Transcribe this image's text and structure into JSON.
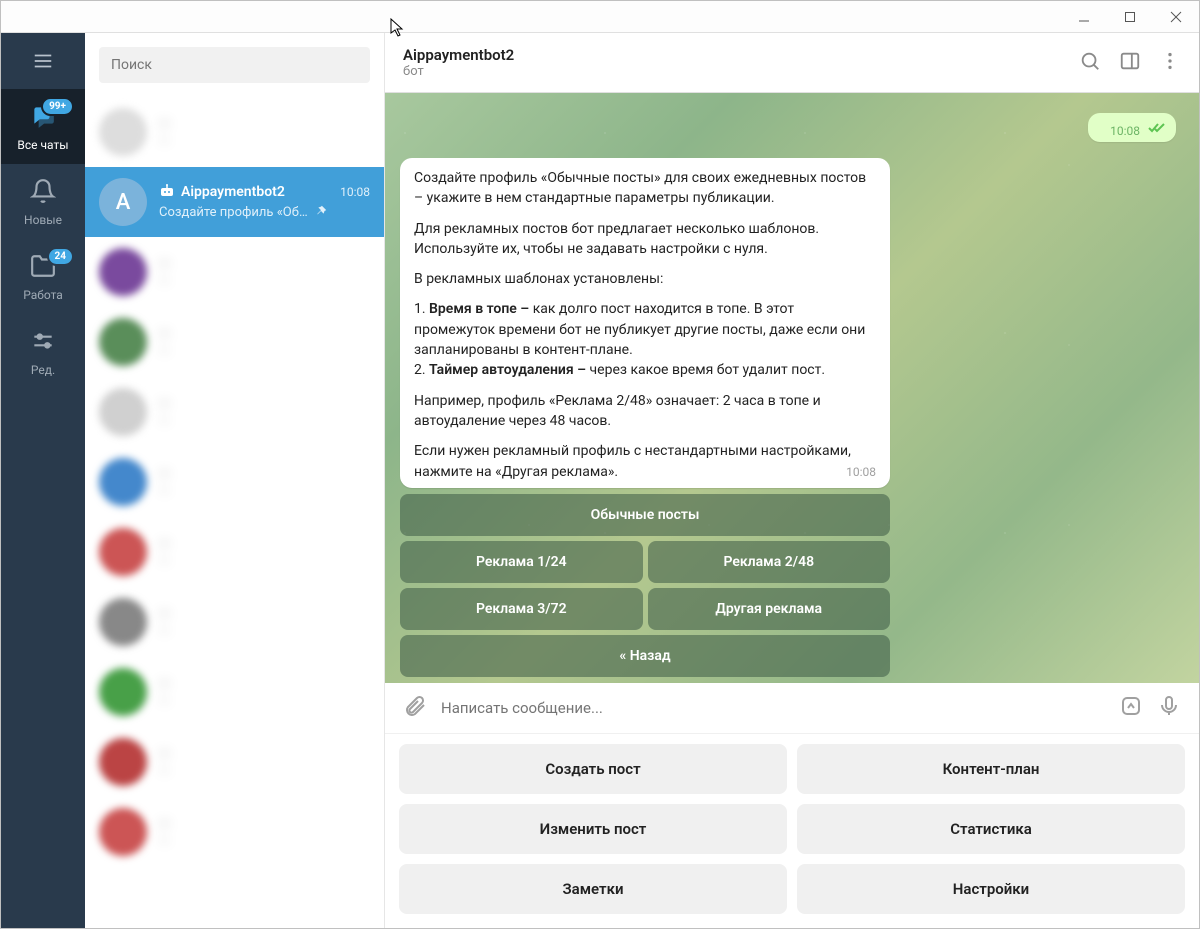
{
  "window": {
    "title": ""
  },
  "nav": {
    "items": [
      {
        "label": "Все чаты",
        "badge": "99+"
      },
      {
        "label": "Новые"
      },
      {
        "label": "Работа",
        "badge": "24"
      },
      {
        "label": "Ред."
      }
    ]
  },
  "search": {
    "placeholder": "Поиск"
  },
  "activeChat": {
    "avatar_letter": "A",
    "name": "Aippaymentbot2",
    "time": "10:08",
    "preview": "Создайте профиль «Об…"
  },
  "header": {
    "title": "Aippaymentbot2",
    "subtitle": "бот"
  },
  "outgoing": {
    "time": "10:08"
  },
  "message": {
    "p1": "Создайте профиль «Обычные посты» для своих ежедневных постов – укажите в нем стандартные параметры публикации.",
    "p2": "Для рекламных постов бот предлагает несколько шаблонов. Используйте их, чтобы не задавать настройки с нуля.",
    "p3": "В рекламных шаблонах установлены:",
    "li1_b": "Время в топе –",
    "li1_t": " как долго пост находится в топе. В этот промежуток времени бот не публикует другие посты, даже если они запланированы в контент-плане.",
    "li2_b": "Таймер автоудаления –",
    "li2_t": " через какое время бот удалит пост.",
    "p4": "Например, профиль «Реклама 2/48» означает: 2 часа в топе и автоудаление через 48 часов.",
    "p5": "Если нужен рекламный профиль с нестандартными настройками, нажмите на «Другая реклама».",
    "time": "10:08"
  },
  "inline_kb": {
    "r0": "Обычные посты",
    "r1a": "Реклама 1/24",
    "r1b": "Реклама 2/48",
    "r2a": "Реклама 3/72",
    "r2b": "Другая реклама",
    "r3": "« Назад"
  },
  "composer": {
    "placeholder": "Написать сообщение..."
  },
  "reply_kb": {
    "b1": "Создать пост",
    "b2": "Контент-план",
    "b3": "Изменить пост",
    "b4": "Статистика",
    "b5": "Заметки",
    "b6": "Настройки"
  }
}
